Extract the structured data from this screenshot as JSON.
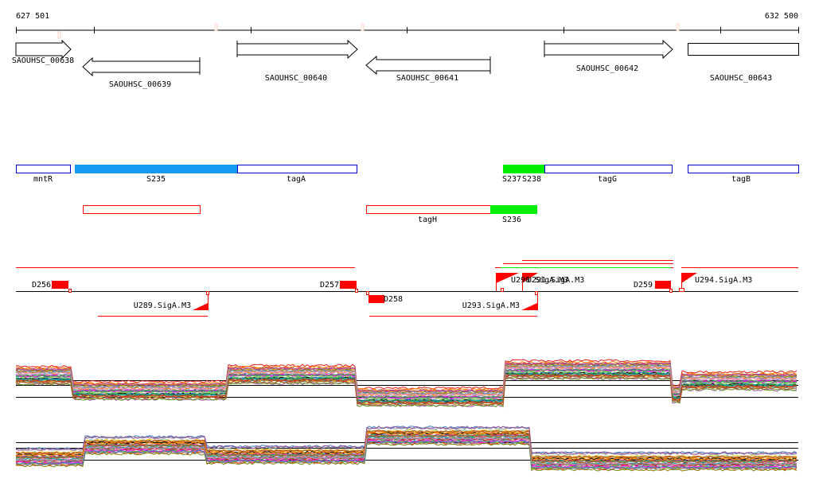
{
  "ruler": {
    "start_label": "627 501",
    "end_label": "632 500"
  },
  "genes": [
    {
      "name": "SAOUHSC_00638",
      "strand": "+"
    },
    {
      "name": "SAOUHSC_00639",
      "strand": "-"
    },
    {
      "name": "SAOUHSC_00640",
      "strand": "+"
    },
    {
      "name": "SAOUHSC_00641",
      "strand": "-"
    },
    {
      "name": "SAOUHSC_00642",
      "strand": "+"
    },
    {
      "name": "SAOUHSC_00643",
      "strand": "+"
    }
  ],
  "features": [
    {
      "label": "mntR"
    },
    {
      "label": "S235"
    },
    {
      "label": "tagA"
    },
    {
      "label": "S237"
    },
    {
      "label": "S238"
    },
    {
      "label": "tagG"
    },
    {
      "label": "tagB"
    },
    {
      "label": "tagH"
    },
    {
      "label": "S236"
    }
  ],
  "sites": [
    {
      "label": "D256"
    },
    {
      "label": "D257"
    },
    {
      "label": "D258"
    },
    {
      "label": "D259"
    },
    {
      "label": "U289.SigA.M3"
    },
    {
      "label": "U290.SigA.M3"
    },
    {
      "label": "U291.SigA.M3"
    },
    {
      "label": "U293.SigA.M3"
    },
    {
      "label": "U294.SigA.M3"
    }
  ],
  "colors": {
    "blue": "#1499f0",
    "green": "#00ee00",
    "red": "#ff0000",
    "outline_blue": "#0000cc"
  }
}
